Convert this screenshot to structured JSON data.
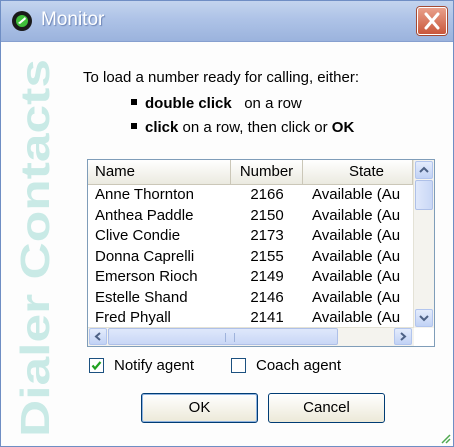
{
  "window": {
    "title": "Monitor",
    "close_icon": "close-icon"
  },
  "watermark": {
    "text": "Dialer Contacts",
    "color": "#c9eae6"
  },
  "instructions": {
    "intro": "To load a number ready for calling, either:",
    "bullet1_bold": "double click",
    "bullet1_rest": "on a row",
    "bullet2_bold": "click",
    "bullet2_mid": "on a row, then click or",
    "bullet2_ok": "OK"
  },
  "list": {
    "columns": [
      "Name",
      "Number",
      "State"
    ],
    "rows": [
      {
        "name": "Anne Thornton",
        "number": "2166",
        "state": "Available (Au"
      },
      {
        "name": "Anthea Paddle",
        "number": "2150",
        "state": "Available (Au"
      },
      {
        "name": "Clive Condie",
        "number": "2173",
        "state": "Available (Au"
      },
      {
        "name": "Donna Caprelli",
        "number": "2155",
        "state": "Available (Au"
      },
      {
        "name": "Emerson Rioch",
        "number": "2149",
        "state": "Available (Au"
      },
      {
        "name": "Estelle Shand",
        "number": "2146",
        "state": "Available (Au"
      },
      {
        "name": "Fred Phyall",
        "number": "2141",
        "state": "Available (Au"
      }
    ]
  },
  "options": {
    "notify_agent": {
      "label": "Notify agent",
      "checked": true
    },
    "coach_agent": {
      "label": "Coach agent",
      "checked": false
    }
  },
  "buttons": {
    "ok": "OK",
    "cancel": "Cancel"
  }
}
